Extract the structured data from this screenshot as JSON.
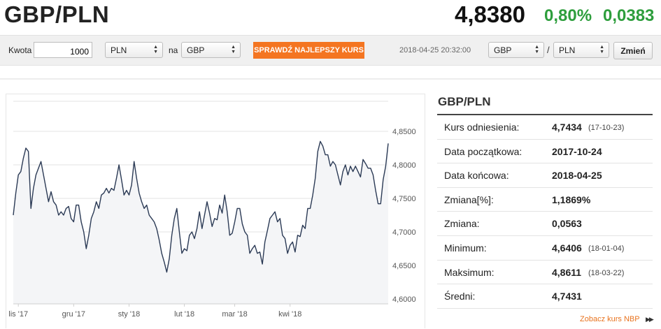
{
  "header": {
    "pair": "GBP/PLN",
    "rate": "4,8380",
    "change_pct": "0,80%",
    "change_abs": "0,0383"
  },
  "toolbar": {
    "amount_label": "Kwota",
    "amount_value": "1000",
    "from_currency": "PLN",
    "to_label": "na",
    "to_currency": "GBP",
    "check_button": "SPRAWDŹ NAJLEPSZY KURS",
    "timestamp": "2018-04-25 20:32:00",
    "pair_base": "GBP",
    "pair_separator": "/",
    "pair_quote": "PLN",
    "change_button": "Zmień"
  },
  "stats": {
    "title": "GBP/PLN",
    "rows": [
      {
        "label": "Kurs odniesienia:",
        "value": "4,7434",
        "date": "(17-10-23)"
      },
      {
        "label": "Data początkowa:",
        "value": "2017-10-24"
      },
      {
        "label": "Data końcowa:",
        "value": "2018-04-25"
      },
      {
        "label": "Zmiana[%]:",
        "value": "1,1869%"
      },
      {
        "label": "Zmiana:",
        "value": "0,0563"
      },
      {
        "label": "Minimum:",
        "value": "4,6406",
        "date": "(18-01-04)"
      },
      {
        "label": "Maksimum:",
        "value": "4,8611",
        "date": "(18-03-22)"
      },
      {
        "label": "Średni:",
        "value": "4,7431"
      }
    ]
  },
  "nbp_link": "Zobacz kurs NBP",
  "colors": {
    "positive": "#2e9e3d",
    "accent": "#f47521",
    "line": "#2b3a55",
    "area": "#f4f5f7"
  },
  "icons": {
    "select_arrows": "up-down-chevron-icon",
    "link_arrows": "double-triangle-right-icon"
  },
  "chart_data": {
    "type": "line",
    "x_tick_labels": [
      "lis '17",
      "gru '17",
      "sty '18",
      "lut '18",
      "mar '18",
      "kwi '18"
    ],
    "x_tick_index": [
      2,
      24,
      46,
      68,
      88,
      110
    ],
    "y_tick_labels": [
      "4,6000",
      "4,6500",
      "4,7000",
      "4,7500",
      "4,8000",
      "4,8500"
    ],
    "ylim": [
      4.6,
      4.85
    ],
    "y_ticks": [
      4.6,
      4.65,
      4.7,
      4.75,
      4.8,
      4.85
    ],
    "grid": "horizontal",
    "values": [
      4.725,
      4.758,
      4.785,
      4.79,
      4.81,
      4.825,
      4.82,
      4.735,
      4.765,
      4.785,
      4.795,
      4.805,
      4.785,
      4.765,
      4.745,
      4.76,
      4.745,
      4.74,
      4.725,
      4.73,
      4.725,
      4.735,
      4.738,
      4.72,
      4.715,
      4.74,
      4.74,
      4.715,
      4.7,
      4.675,
      4.695,
      4.72,
      4.73,
      4.745,
      4.735,
      4.755,
      4.758,
      4.765,
      4.758,
      4.765,
      4.762,
      4.78,
      4.8,
      4.778,
      4.755,
      4.762,
      4.755,
      4.77,
      4.805,
      4.78,
      4.758,
      4.745,
      4.735,
      4.74,
      4.725,
      4.72,
      4.715,
      4.705,
      4.688,
      4.668,
      4.655,
      4.64,
      4.66,
      4.695,
      4.72,
      4.735,
      4.7,
      4.668,
      4.675,
      4.672,
      4.695,
      4.7,
      4.69,
      4.705,
      4.73,
      4.705,
      4.725,
      4.745,
      4.728,
      4.708,
      4.72,
      4.718,
      4.74,
      4.728,
      4.755,
      4.73,
      4.695,
      4.698,
      4.715,
      4.735,
      4.735,
      4.712,
      4.7,
      4.695,
      4.668,
      4.675,
      4.68,
      4.668,
      4.67,
      4.652,
      4.685,
      4.702,
      4.72,
      4.725,
      4.73,
      4.715,
      4.72,
      4.695,
      4.69,
      4.668,
      4.68,
      4.685,
      4.67,
      4.695,
      4.693,
      4.71,
      4.705,
      4.735,
      4.735,
      4.755,
      4.78,
      4.82,
      4.835,
      4.828,
      4.815,
      4.815,
      4.798,
      4.805,
      4.8,
      4.785,
      4.77,
      4.79,
      4.8,
      4.785,
      4.798,
      4.79,
      4.798,
      4.79,
      4.782,
      4.808,
      4.802,
      4.795,
      4.795,
      4.785,
      4.762,
      4.742,
      4.742,
      4.778,
      4.798,
      4.832
    ]
  }
}
